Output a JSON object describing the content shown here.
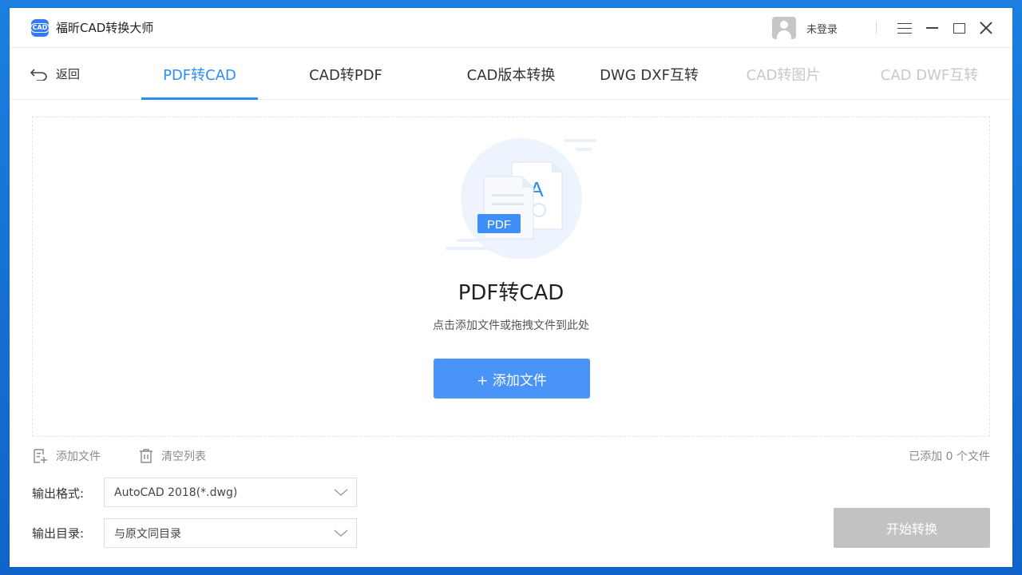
{
  "app": {
    "title": "福昕CAD转换大师",
    "logo_text": "CAD"
  },
  "account": {
    "login_label": "未登录"
  },
  "nav": {
    "back_label": "返回"
  },
  "tabs": [
    {
      "label": "PDF转CAD",
      "state": "active"
    },
    {
      "label": "CAD转PDF",
      "state": "normal"
    },
    {
      "label": "CAD版本转换",
      "state": "normal"
    },
    {
      "label": "DWG DXF互转",
      "state": "normal"
    },
    {
      "label": "CAD转图片",
      "state": "disabled"
    },
    {
      "label": "CAD DWF互转",
      "state": "disabled"
    }
  ],
  "dropzone": {
    "title": "PDF转CAD",
    "hint": "点击添加文件或拖拽文件到此处",
    "add_button": "+ 添加文件",
    "illustration_badge": "PDF",
    "illustration_letter": "A"
  },
  "toolbar": {
    "add_file": "添加文件",
    "clear_list": "清空列表",
    "file_count": "已添加 0 个文件"
  },
  "output": {
    "format_label": "输出格式:",
    "format_value": "AutoCAD 2018(*.dwg)",
    "dir_label": "输出目录:",
    "dir_value": "与原文同目录"
  },
  "actions": {
    "start": "开始转换"
  },
  "colors": {
    "accent": "#2f8cf5",
    "button": "#4a93f8",
    "disabled_button": "#c2c2c2",
    "disabled_tab": "#c8c8c8"
  }
}
